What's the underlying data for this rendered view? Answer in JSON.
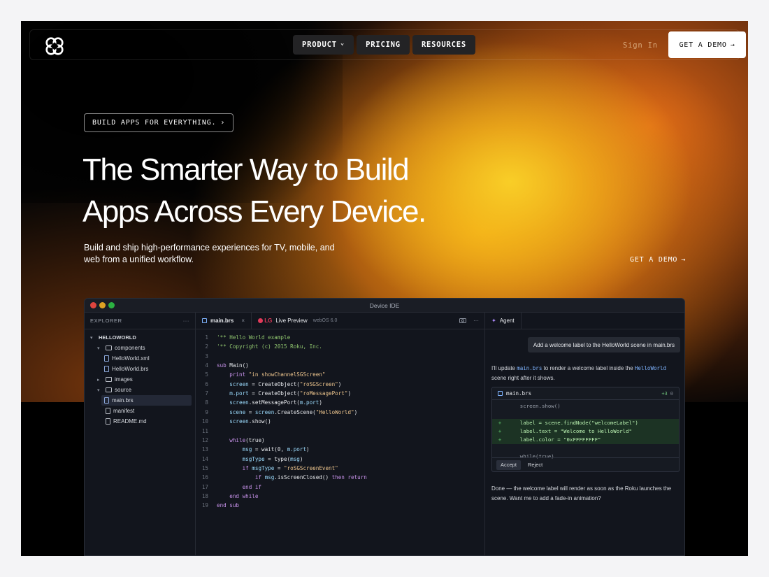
{
  "nav": {
    "items": [
      {
        "label": "PRODUCT",
        "has_dropdown": true
      },
      {
        "label": "PRICING",
        "has_dropdown": false
      },
      {
        "label": "RESOURCES",
        "has_dropdown": false
      }
    ],
    "signin": "Sign In",
    "demo": "GET A DEMO",
    "arrow": "→",
    "chevron": "⌄"
  },
  "hero": {
    "pill": "BUILD APPS FOR EVERYTHING.",
    "pill_arrow": "›",
    "headline_1": "The Smarter Way to Build",
    "headline_2": "Apps Across Every Device.",
    "sub": "Build and ship high-performance experiences for TV, mobile, and web from a unified workflow.",
    "demo": "GET A DEMO",
    "demo_arrow": "→"
  },
  "ide": {
    "title": "Device IDE",
    "window_dot_colors": [
      "#e0443e",
      "#dea123",
      "#2bb141"
    ],
    "explorer": {
      "title": "EXPLORER",
      "menu": "···",
      "tree": [
        {
          "label": "HELLOWORLD",
          "type": "root",
          "expanded": true,
          "depth": 0
        },
        {
          "label": "components",
          "type": "folder",
          "expanded": true,
          "depth": 1
        },
        {
          "label": "HelloWorld.xml",
          "type": "file",
          "depth": 2
        },
        {
          "label": "HelloWorld.brs",
          "type": "file",
          "depth": 2
        },
        {
          "label": "images",
          "type": "folder",
          "expanded": false,
          "depth": 1
        },
        {
          "label": "source",
          "type": "folder",
          "expanded": true,
          "depth": 1
        },
        {
          "label": "main.brs",
          "type": "file",
          "depth": 2,
          "selected": true
        },
        {
          "label": "manifest",
          "type": "plain",
          "depth": 1
        },
        {
          "label": "README.md",
          "type": "plain",
          "depth": 1
        }
      ]
    },
    "editor": {
      "tab_active": "main.brs",
      "tab_close": "×",
      "tab_preview_brand": "LG",
      "tab_preview": "Live Preview",
      "tab_preview_os": "webOS 6.0",
      "icons": [
        "camera-icon",
        "more-icon"
      ],
      "lines": [
        [
          {
            "t": "'** Hello World example",
            "c": "cm"
          }
        ],
        [
          {
            "t": "'** Copyright (c) 2015 Roku, Inc.",
            "c": "cm"
          }
        ],
        [],
        [
          {
            "t": "sub ",
            "c": "kw"
          },
          {
            "t": "Main()",
            "c": "fn"
          }
        ],
        [
          {
            "t": "    print ",
            "c": "kw"
          },
          {
            "t": "\"in showChannelSGScreen\"",
            "c": "str"
          }
        ],
        [
          {
            "t": "    screen",
            "c": "var"
          },
          {
            "t": " = CreateObject(",
            "c": "fn"
          },
          {
            "t": "\"roSGScreen\"",
            "c": "str"
          },
          {
            "t": ")",
            "c": "fn"
          }
        ],
        [
          {
            "t": "    m.port",
            "c": "var"
          },
          {
            "t": " = CreateObject(",
            "c": "fn"
          },
          {
            "t": "\"roMessagePort\"",
            "c": "str"
          },
          {
            "t": ")",
            "c": "fn"
          }
        ],
        [
          {
            "t": "    screen",
            "c": "var"
          },
          {
            "t": ".setMessagePort(",
            "c": "fn"
          },
          {
            "t": "m.port",
            "c": "var"
          },
          {
            "t": ")",
            "c": "fn"
          }
        ],
        [
          {
            "t": "    scene",
            "c": "var"
          },
          {
            "t": " = ",
            "c": "fn"
          },
          {
            "t": "screen",
            "c": "var"
          },
          {
            "t": ".CreateScene(",
            "c": "fn"
          },
          {
            "t": "\"HelloWorld\"",
            "c": "str"
          },
          {
            "t": ")",
            "c": "fn"
          }
        ],
        [
          {
            "t": "    screen",
            "c": "var"
          },
          {
            "t": ".show()",
            "c": "fn"
          }
        ],
        [],
        [
          {
            "t": "    while",
            "c": "kw"
          },
          {
            "t": "(true)",
            "c": "fn"
          }
        ],
        [
          {
            "t": "        msg",
            "c": "var"
          },
          {
            "t": " = wait(0, ",
            "c": "fn"
          },
          {
            "t": "m.port",
            "c": "var"
          },
          {
            "t": ")",
            "c": "fn"
          }
        ],
        [
          {
            "t": "        msgType",
            "c": "var"
          },
          {
            "t": " = type(",
            "c": "fn"
          },
          {
            "t": "msg",
            "c": "var"
          },
          {
            "t": ")",
            "c": "fn"
          }
        ],
        [
          {
            "t": "        if ",
            "c": "kw"
          },
          {
            "t": "msgType",
            "c": "var"
          },
          {
            "t": " = ",
            "c": "fn"
          },
          {
            "t": "\"roSGScreenEvent\"",
            "c": "str"
          }
        ],
        [
          {
            "t": "            if ",
            "c": "kw"
          },
          {
            "t": "msg",
            "c": "var"
          },
          {
            "t": ".isScreenClosed() ",
            "c": "fn"
          },
          {
            "t": "then return",
            "c": "kw"
          }
        ],
        [
          {
            "t": "        end if",
            "c": "kw"
          }
        ],
        [
          {
            "t": "    end while",
            "c": "kw"
          }
        ],
        [
          {
            "t": "end sub",
            "c": "kw"
          }
        ]
      ]
    },
    "agent": {
      "tab": "Agent",
      "user_message": "Add a welcome label to the HelloWorld scene in main.brs",
      "reply_1_pre": "I'll update ",
      "reply_1_code1": "main.brs",
      "reply_1_mid": " to render a welcome label inside the ",
      "reply_1_code2": "HelloWorld",
      "reply_1_post": " scene right after it shows.",
      "diff": {
        "file": "main.brs",
        "added": "+3",
        "removed": "0",
        "lines": [
          {
            "type": "ctx",
            "text": "screen.show()"
          },
          {
            "type": "gap",
            "text": ""
          },
          {
            "type": "add",
            "text": "label = scene.findNode(\"welcomeLabel\")"
          },
          {
            "type": "add",
            "text": "label.text = \"Welcome to HelloWorld\""
          },
          {
            "type": "add",
            "text": "label.color = \"0xFFFFFFFF\""
          },
          {
            "type": "gap",
            "text": ""
          },
          {
            "type": "ctx",
            "text": "while(true)"
          }
        ],
        "accept": "Accept",
        "reject": "Reject"
      },
      "reply_2": "Done — the welcome label will render as soon as the Roku launches the scene. Want me to add a fade-in animation?"
    }
  },
  "colors": {
    "accent_orange": "#f08a1c",
    "accent_yellow": "#f6c91f",
    "ide_bg": "#12151d"
  }
}
